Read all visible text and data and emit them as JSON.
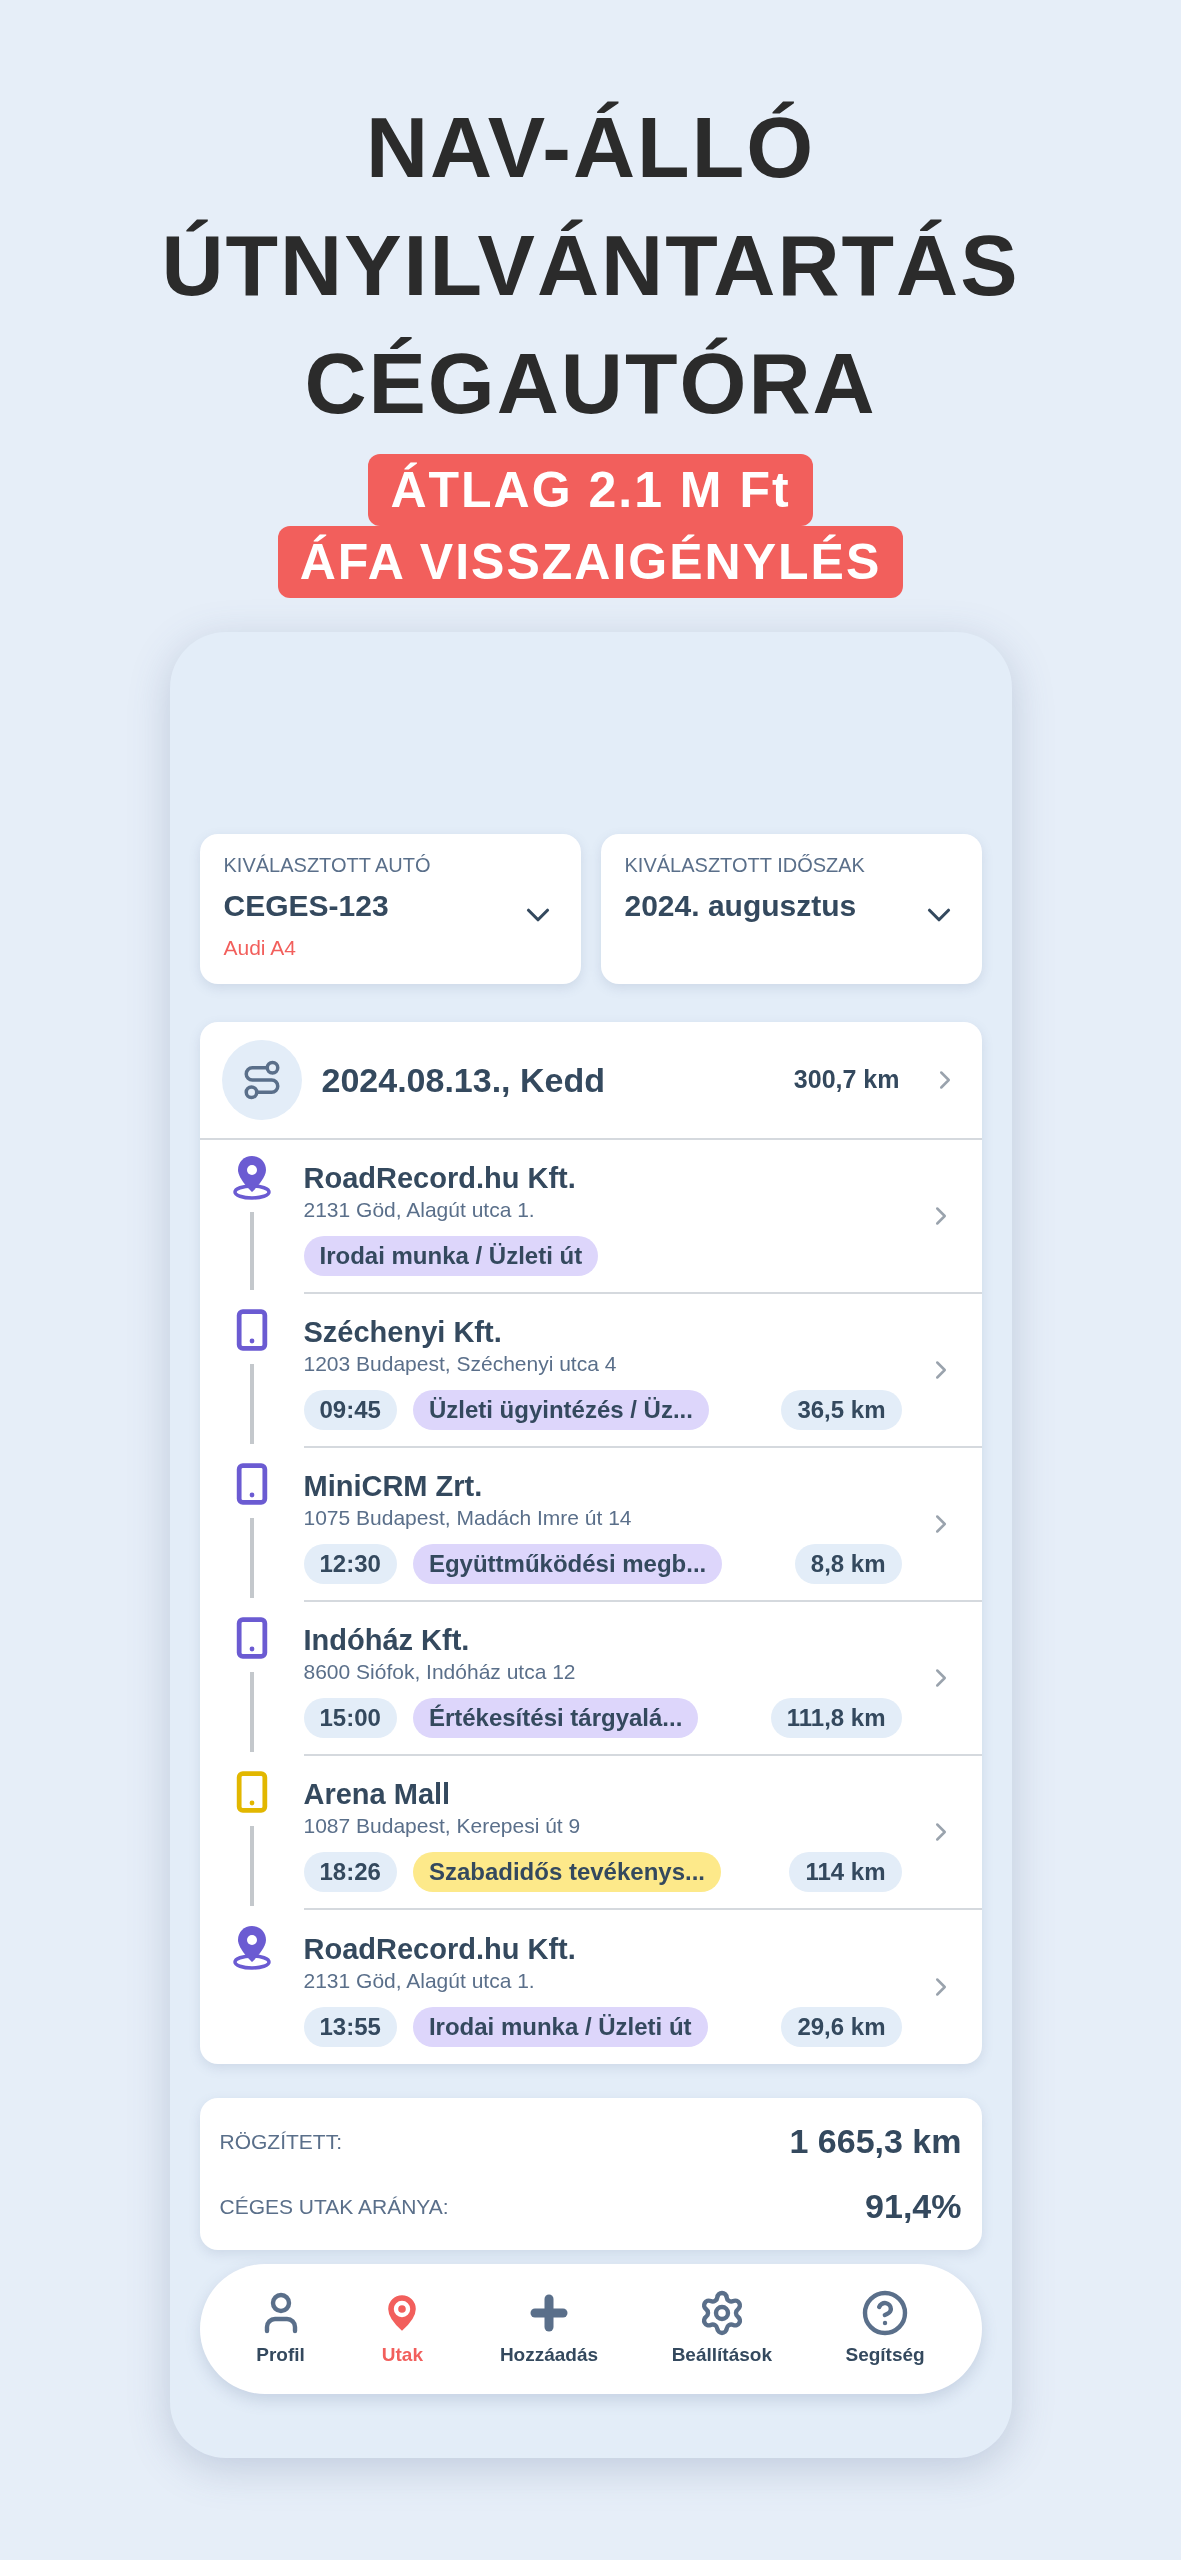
{
  "headline": [
    "NAV-ÁLLÓ",
    "ÚTNYILVÁNTARTÁS",
    "CÉGAUTÓRA"
  ],
  "badges": [
    "ÁTLAG 2.1 M Ft",
    "ÁFA VISSZAIGÉNYLÉS"
  ],
  "selectors": [
    {
      "label": "KIVÁLASZTOTT AUTÓ",
      "value": "CEGES-123",
      "sub": "Audi A4"
    },
    {
      "label": "KIVÁLASZTOTT IDŐSZAK",
      "value": "2024. augusztus"
    }
  ],
  "day": {
    "date": "2024.08.13., Kedd",
    "distance": "300,7 km"
  },
  "stops": [
    {
      "kind": "location",
      "color": "#6b5bd2",
      "name": "RoadRecord.hu Kft.",
      "address": "2131 Göd, Alagút utca 1.",
      "tag": {
        "text": "Irodai munka / Üzleti út",
        "color": "#ddd6fb"
      }
    },
    {
      "kind": "phone",
      "color": "#6b5bd2",
      "name": "Széchenyi Kft.",
      "address": "1203 Budapest, Széchenyi utca 4",
      "time": "09:45",
      "tag": {
        "text": "Üzleti ügyintézés / Üz...",
        "color": "#ddd6fb"
      },
      "distance": "36,5 km"
    },
    {
      "kind": "phone",
      "color": "#6b5bd2",
      "name": "MiniCRM Zrt.",
      "address": "1075 Budapest, Madách Imre út 14",
      "time": "12:30",
      "tag": {
        "text": "Együttműködési megb...",
        "color": "#ddd6fb"
      },
      "distance": "8,8 km"
    },
    {
      "kind": "phone",
      "color": "#6b5bd2",
      "name": "Indóház Kft.",
      "address": "8600 Siófok, Indóház utca 12",
      "time": "15:00",
      "tag": {
        "text": "Értékesítési tárgyalá...",
        "color": "#ddd6fb"
      },
      "distance": "111,8 km"
    },
    {
      "kind": "phone",
      "color": "#e2b700",
      "name": "Arena Mall",
      "address": "1087 Budapest, Kerepesi út 9",
      "time": "18:26",
      "tag": {
        "text": "Szabadidős tevékenys...",
        "color": "#fde98a"
      },
      "distance": "114 km"
    },
    {
      "kind": "location",
      "color": "#6b5bd2",
      "name": "RoadRecord.hu Kft.",
      "address": "2131 Göd, Alagút utca 1.",
      "time": "13:55",
      "tag": {
        "text": "Irodai munka / Üzleti út",
        "color": "#ddd6fb"
      },
      "distance": "29,6 km"
    }
  ],
  "summary": [
    {
      "label": "RÖGZÍTETT:",
      "value": "1 665,3 km"
    },
    {
      "label": "CÉGES UTAK ARÁNYA:",
      "value": "91,4%"
    }
  ],
  "nav": [
    {
      "kind": "profile",
      "label": "Profil",
      "selected": false
    },
    {
      "kind": "trips",
      "label": "Utak",
      "selected": true
    },
    {
      "kind": "add",
      "label": "Hozzáadás",
      "selected": false
    },
    {
      "kind": "settings",
      "label": "Beállítások",
      "selected": false
    },
    {
      "kind": "help",
      "label": "Segítség",
      "selected": false
    }
  ]
}
